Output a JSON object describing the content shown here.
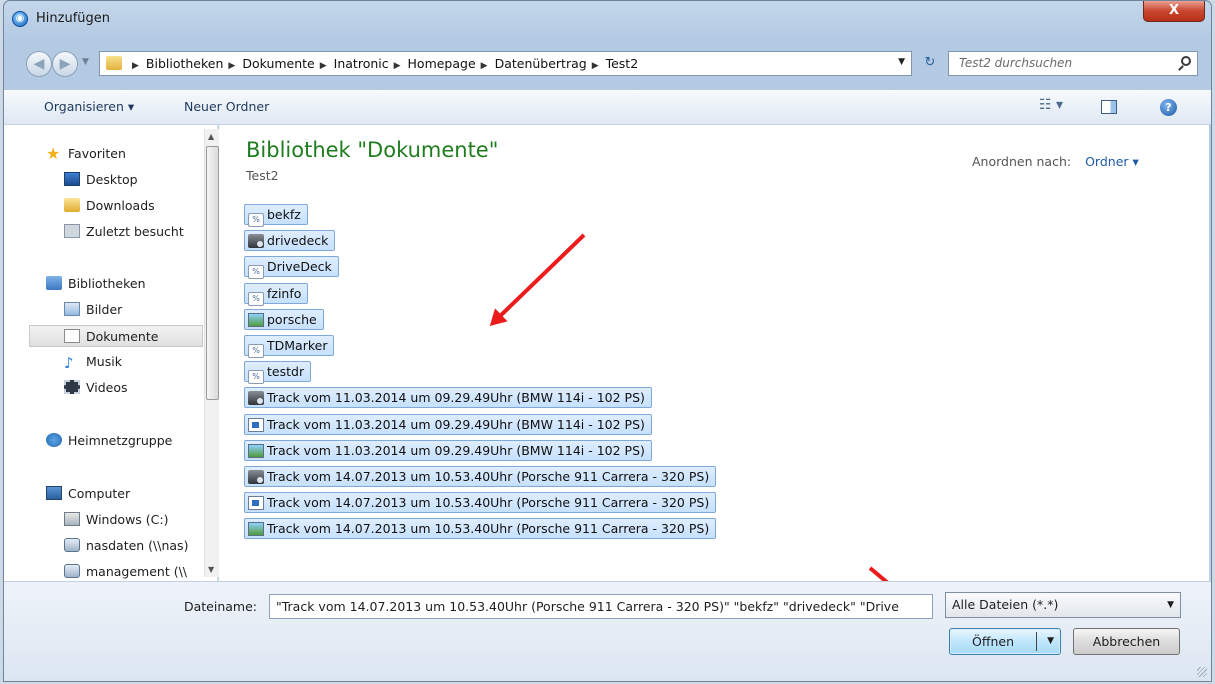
{
  "window": {
    "title": "Hinzufügen",
    "close_label": "X"
  },
  "nav": {
    "breadcrumbs": [
      "Bibliotheken",
      "Dokumente",
      "Inatronic",
      "Homepage",
      "Datenübertrag",
      "Test2"
    ],
    "search_placeholder": "Test2 durchsuchen"
  },
  "toolbar": {
    "organize": "Organisieren ▾",
    "new_folder": "Neuer Ordner"
  },
  "sidebar": {
    "favorites": "Favoriten",
    "fav_items": [
      "Desktop",
      "Downloads",
      "Zuletzt besucht"
    ],
    "libraries": "Bibliotheken",
    "lib_items": [
      "Bilder",
      "Dokumente",
      "Musik",
      "Videos"
    ],
    "homegroup": "Heimnetzgruppe",
    "computer": "Computer",
    "comp_items": [
      "Windows (C:)",
      "nasdaten (\\\\nas)",
      "management (\\\\"
    ]
  },
  "content": {
    "title": "Bibliothek \"Dokumente\"",
    "subtitle": "Test2",
    "arrange_label": "Anordnen nach:",
    "arrange_value": "Ordner ▾",
    "files": [
      {
        "name": "bekfz",
        "icon": "link-file-icon"
      },
      {
        "name": "drivedeck",
        "icon": "app-file-icon"
      },
      {
        "name": "DriveDeck",
        "icon": "link-file-icon"
      },
      {
        "name": "fzinfo",
        "icon": "link-file-icon"
      },
      {
        "name": "porsche",
        "icon": "image-file-icon"
      },
      {
        "name": "TDMarker",
        "icon": "link-file-icon"
      },
      {
        "name": "testdr",
        "icon": "link-file-icon"
      },
      {
        "name": "Track vom 11.03.2014 um 09.29.49Uhr (BMW 114i - 102 PS)",
        "icon": "app-file-icon"
      },
      {
        "name": "Track vom 11.03.2014 um 09.29.49Uhr (BMW 114i - 102 PS)",
        "icon": "doc-file-icon"
      },
      {
        "name": "Track vom 11.03.2014 um 09.29.49Uhr (BMW 114i - 102 PS)",
        "icon": "image-file-icon"
      },
      {
        "name": "Track vom 14.07.2013 um 10.53.40Uhr (Porsche 911 Carrera - 320 PS)",
        "icon": "app-file-icon"
      },
      {
        "name": "Track vom 14.07.2013 um 10.53.40Uhr (Porsche 911 Carrera - 320 PS)",
        "icon": "doc-file-icon"
      },
      {
        "name": "Track vom 14.07.2013 um 10.53.40Uhr (Porsche 911 Carrera - 320 PS)",
        "icon": "image-file-icon"
      }
    ]
  },
  "footer": {
    "filename_label": "Dateiname:",
    "filename_value": "\"Track vom 14.07.2013 um 10.53.40Uhr (Porsche 911 Carrera - 320 PS)\" \"bekfz\" \"drivedeck\" \"Drive",
    "filter_value": "Alle Dateien (*.*)",
    "open_label": "Öffnen",
    "cancel_label": "Abbrechen"
  },
  "colors": {
    "annotation_arrow": "#ec1c1c",
    "library_title": "#1f7d1f",
    "selection": "#cce4fd"
  }
}
